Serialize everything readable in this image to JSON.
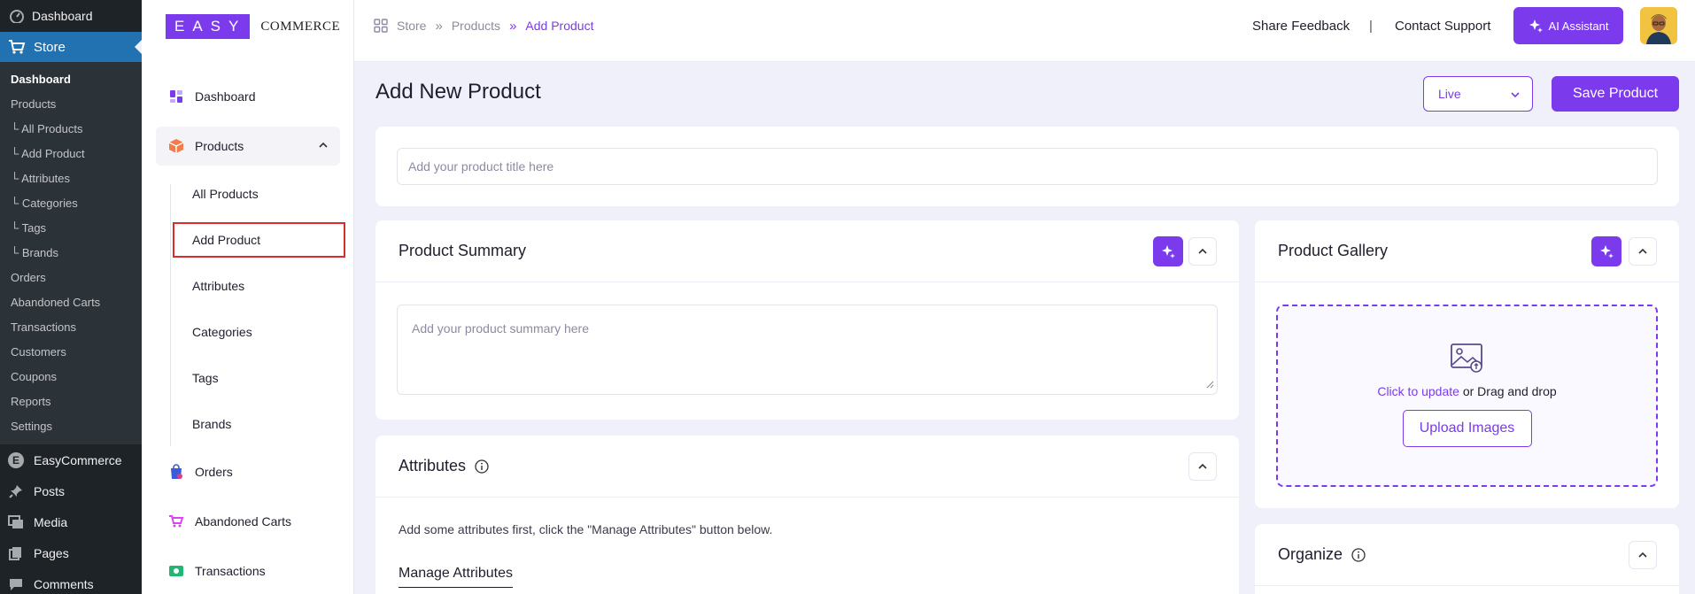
{
  "wp_sidebar": {
    "dashboard": "Dashboard",
    "store": "Store",
    "store_submenu": [
      "Dashboard",
      "Products",
      "└ All Products",
      "└ Add Product",
      "└ Attributes",
      "└ Categories",
      "└ Tags",
      "└ Brands",
      "Orders",
      "Abandoned Carts",
      "Transactions",
      "Customers",
      "Coupons",
      "Reports",
      "Settings"
    ],
    "easycommerce": "EasyCommerce",
    "posts": "Posts",
    "media": "Media",
    "pages": "Pages",
    "comments": "Comments"
  },
  "logo": {
    "box": "EASY",
    "text": "COMMERCE"
  },
  "plugin_nav": {
    "dashboard": "Dashboard",
    "products": "Products",
    "product_subitems": [
      "All Products",
      "Add Product",
      "Attributes",
      "Categories",
      "Tags",
      "Brands"
    ],
    "orders": "Orders",
    "abandoned_carts": "Abandoned Carts",
    "transactions": "Transactions"
  },
  "breadcrumb": [
    "Store",
    "Products",
    "Add Product"
  ],
  "header": {
    "share_feedback": "Share Feedback",
    "divider": "|",
    "contact_support": "Contact Support",
    "ai_assistant": "AI Assistant"
  },
  "main": {
    "page_title": "Add New Product",
    "status_value": "Live",
    "save_button": "Save Product",
    "title_placeholder": "Add your product title here",
    "summary_title": "Product Summary",
    "summary_placeholder": "Add your product summary here",
    "attributes_title": "Attributes",
    "attributes_text": "Add some attributes first, click the \"Manage Attributes\" button below.",
    "manage_attributes": "Manage Attributes",
    "gallery_title": "Product Gallery",
    "gallery_click": "Click to update",
    "gallery_or": " or Drag and drop",
    "upload_button": "Upload Images",
    "organize_title": "Organize"
  },
  "colors": {
    "accent": "#7c3aed",
    "wp_sidebar": "#1d2327",
    "wp_active": "#2271b1",
    "highlight_border": "#d92c2c"
  }
}
